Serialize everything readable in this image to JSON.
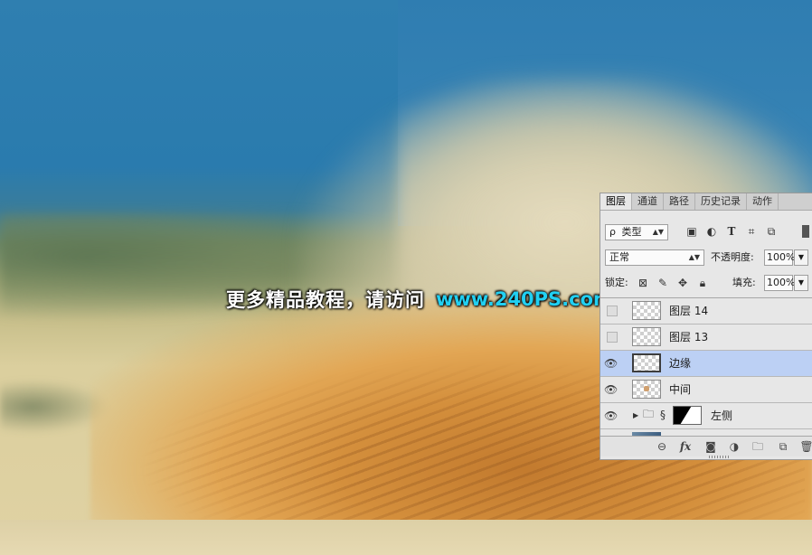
{
  "watermark": {
    "text_cn": "更多精品教程，请访问",
    "url": "www.240PS.com"
  },
  "layers_panel": {
    "tabs": [
      {
        "label": "图层",
        "active": true
      },
      {
        "label": "通道",
        "active": false
      },
      {
        "label": "路径",
        "active": false
      },
      {
        "label": "历史记录",
        "active": false
      },
      {
        "label": "动作",
        "active": false
      }
    ],
    "filter": {
      "search_symbol": "ρ",
      "kind_label": "类型"
    },
    "blend_mode": "正常",
    "opacity_label": "不透明度:",
    "opacity_value": "100%",
    "lock_label": "锁定:",
    "fill_label": "填充:",
    "fill_value": "100%",
    "layers": [
      {
        "name": "图层 14",
        "visible": false,
        "selected": false
      },
      {
        "name": "图层 13",
        "visible": false,
        "selected": false
      },
      {
        "name": "边缘",
        "visible": true,
        "selected": true
      },
      {
        "name": "中间",
        "visible": true,
        "selected": false
      },
      {
        "name": "左侧",
        "visible": true,
        "selected": false,
        "type": "group-with-mask"
      }
    ],
    "footer_icons": [
      "link-icon",
      "fx-icon",
      "add-mask-icon",
      "adjustment-icon",
      "new-group-icon",
      "new-layer-icon",
      "trash-icon"
    ],
    "fx_label": "fx"
  },
  "colors": {
    "selected_layer": "#bcd0f4",
    "watermark_url": "#21d0f2",
    "panel_bg": "#e7e7e7"
  }
}
